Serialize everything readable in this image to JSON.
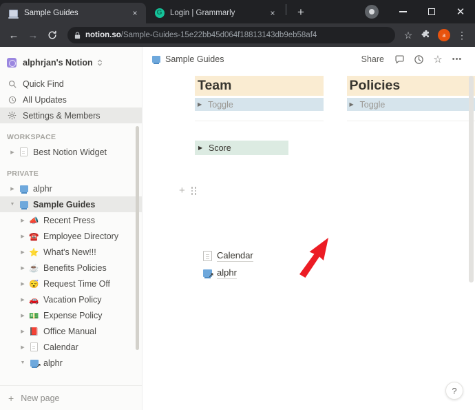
{
  "browser": {
    "tabs": [
      {
        "title": "Sample Guides",
        "favicon": "notion-monitor-icon",
        "active": true,
        "close_label": "×"
      },
      {
        "title": "Login | Grammarly",
        "favicon": "grammarly-icon",
        "active": false,
        "close_label": "×"
      }
    ],
    "new_tab_label": "+",
    "window_controls": {
      "minimize": "–",
      "maximize": "□",
      "close": "✕"
    },
    "toolbar": {
      "back": "←",
      "forward": "→",
      "reload": "⟳",
      "url_domain": "notion.so",
      "url_path": "/Sample-Guides-15e22bb45d064f18813143db9eb58af4",
      "bookmark": "☆",
      "extensions": "puzzle-piece-icon",
      "profile_initial": "a",
      "menu": "⋮"
    }
  },
  "sidebar": {
    "workspace": {
      "name": "alphrjan's Notion"
    },
    "nav": [
      {
        "label": "Quick Find",
        "icon": "search-icon",
        "selected": false
      },
      {
        "label": "All Updates",
        "icon": "clock-icon",
        "selected": false
      },
      {
        "label": "Settings & Members",
        "icon": "gear-icon",
        "selected": true
      }
    ],
    "sections": [
      {
        "label": "WORKSPACE",
        "items": [
          {
            "label": "Best Notion Widget",
            "icon": "page-icon",
            "expanded": false,
            "depth": 0,
            "selected": false
          }
        ]
      },
      {
        "label": "PRIVATE",
        "items": [
          {
            "label": "alphr",
            "icon": "monitor-icon",
            "expanded": false,
            "depth": 0,
            "selected": false
          },
          {
            "label": "Sample Guides",
            "icon": "monitor-icon",
            "expanded": true,
            "depth": 0,
            "selected": true
          },
          {
            "label": "Recent Press",
            "icon": "📣",
            "expanded": false,
            "depth": 1,
            "selected": false
          },
          {
            "label": "Employee Directory",
            "icon": "☎️",
            "expanded": false,
            "depth": 1,
            "selected": false
          },
          {
            "label": "What's New!!!",
            "icon": "⭐",
            "expanded": false,
            "depth": 1,
            "selected": false
          },
          {
            "label": "Benefits Policies",
            "icon": "☕",
            "expanded": false,
            "depth": 1,
            "selected": false
          },
          {
            "label": "Request Time Off",
            "icon": "😴",
            "expanded": false,
            "depth": 1,
            "selected": false
          },
          {
            "label": "Vacation Policy",
            "icon": "🚗",
            "expanded": false,
            "depth": 1,
            "selected": false
          },
          {
            "label": "Expense Policy",
            "icon": "💵",
            "expanded": false,
            "depth": 1,
            "selected": false
          },
          {
            "label": "Office Manual",
            "icon": "📕",
            "expanded": false,
            "depth": 1,
            "selected": false
          },
          {
            "label": "Calendar",
            "icon": "page-icon",
            "expanded": false,
            "depth": 1,
            "selected": false
          },
          {
            "label": "alphr",
            "icon": "monitor-link-icon",
            "expanded": true,
            "depth": 1,
            "selected": false
          }
        ]
      }
    ],
    "new_page_label": "New page",
    "new_page_plus": "+"
  },
  "main": {
    "breadcrumb": "Sample Guides",
    "actions": {
      "share": "Share",
      "comments": "comment-icon",
      "updates": "clock-icon",
      "favorite": "☆",
      "more": "•••"
    },
    "columns": [
      {
        "heading": "Team",
        "toggle": "Toggle"
      },
      {
        "heading": "Policies",
        "toggle": "Toggle"
      }
    ],
    "score_block": {
      "label": "Score"
    },
    "block_handles": {
      "add": "+",
      "drag": "drag-handle-icon"
    },
    "page_links": [
      {
        "label": "Calendar",
        "icon": "page-icon"
      },
      {
        "label": "alphr",
        "icon": "monitor-link-icon"
      }
    ],
    "help_label": "?"
  },
  "annotation": {
    "type": "red-arrow",
    "color": "#ec1c24",
    "points_to": "add-block-button"
  }
}
